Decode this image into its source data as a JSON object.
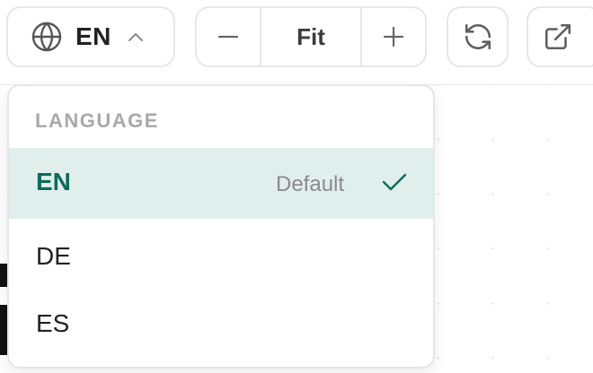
{
  "toolbar": {
    "language_button": {
      "current": "EN",
      "icon": "globe-icon",
      "chevron": "chevron-up-icon"
    },
    "zoom": {
      "decrease_icon": "minus-icon",
      "label": "Fit",
      "increase_icon": "plus-icon"
    },
    "refresh_icon": "refresh-icon",
    "open_external_icon": "external-link-icon"
  },
  "language_menu": {
    "heading": "LANGUAGE",
    "options": [
      {
        "code": "EN",
        "note": "Default",
        "selected": true
      },
      {
        "code": "DE"
      },
      {
        "code": "ES"
      }
    ]
  },
  "colors": {
    "accent": "#0f6b5a",
    "selected_bg": "#e1efec",
    "border": "#e7e7e7",
    "muted_text": "#a9a9a9"
  }
}
